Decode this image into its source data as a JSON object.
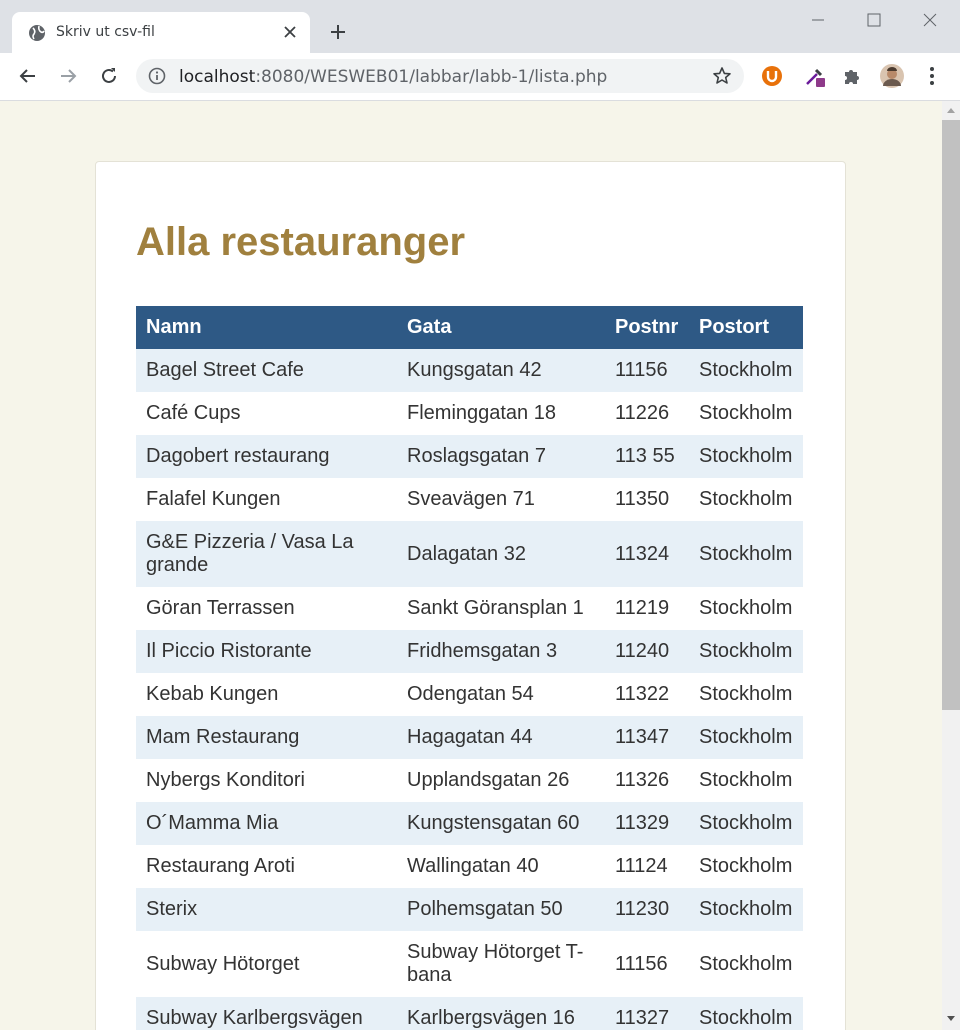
{
  "browser": {
    "tab_title": "Skriv ut csv-fil",
    "url_host": "localhost",
    "url_rest": ":8080/WESWEB01/labbar/labb-1/lista.php"
  },
  "page": {
    "title": "Alla restauranger"
  },
  "table": {
    "headers": [
      "Namn",
      "Gata",
      "Postnr",
      "Postort"
    ],
    "rows": [
      [
        "Bagel Street Cafe",
        "Kungsgatan 42",
        "11156",
        "Stockholm"
      ],
      [
        "Café Cups",
        "Fleminggatan 18",
        "11226",
        "Stockholm"
      ],
      [
        "Dagobert restaurang",
        "Roslagsgatan 7",
        "113 55",
        "Stockholm"
      ],
      [
        "Falafel Kungen",
        "Sveavägen 71",
        "11350",
        "Stockholm"
      ],
      [
        "G&E Pizzeria / Vasa La grande",
        "Dalagatan 32",
        "11324",
        "Stockholm"
      ],
      [
        "Göran Terrassen",
        "Sankt Göransplan 1",
        "11219",
        "Stockholm"
      ],
      [
        "Il Piccio Ristorante",
        "Fridhemsgatan 3",
        "11240",
        "Stockholm"
      ],
      [
        "Kebab Kungen",
        "Odengatan 54",
        "11322",
        "Stockholm"
      ],
      [
        "Mam Restaurang",
        "Hagagatan 44",
        "11347",
        "Stockholm"
      ],
      [
        "Nybergs Konditori",
        "Upplandsgatan 26",
        "11326",
        "Stockholm"
      ],
      [
        "O´Mamma Mia",
        "Kungstensgatan 60",
        "11329",
        "Stockholm"
      ],
      [
        "Restaurang Aroti",
        "Wallingatan 40",
        "11124",
        "Stockholm"
      ],
      [
        "Sterix",
        "Polhemsgatan 50",
        "11230",
        "Stockholm"
      ],
      [
        "Subway Hötorget",
        "Subway Hötorget T-bana",
        "11156",
        "Stockholm"
      ],
      [
        "Subway Karlbergsvägen",
        "Karlbergsvägen 16",
        "11327",
        "Stockholm"
      ]
    ]
  },
  "colors": {
    "title": "#a0803e",
    "header_bg": "#2e5985",
    "stripe": "#e7f0f7",
    "page_bg": "#f6f5ea"
  }
}
